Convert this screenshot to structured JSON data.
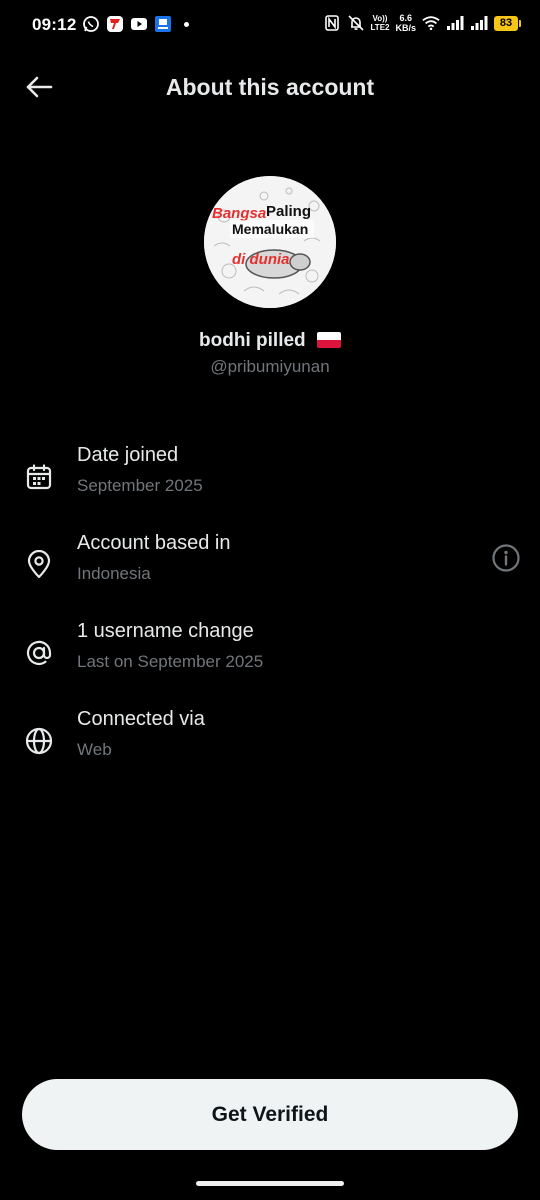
{
  "status_bar": {
    "time": "09:12",
    "volte_top": "Vo))",
    "volte_label": "VoLTE",
    "network_label": "LTE2",
    "speed_value": "6.6",
    "speed_unit": "KB/s",
    "battery": "83",
    "icons": [
      "whatsapp-icon",
      "telkomsel-icon",
      "youtube-icon",
      "app-icon",
      "notification-dot",
      "nfc-icon",
      "mute-icon",
      "wifi-icon",
      "signal-icon",
      "signal-icon",
      "battery-icon"
    ]
  },
  "header": {
    "title": "About this account"
  },
  "profile": {
    "display_name": "bodhi pilled",
    "handle": "@pribumiyunan",
    "avatar_text": {
      "line1a": "Bangsa",
      "line1b": "Paling",
      "line2": "Memalukan",
      "line3": "di dunia"
    }
  },
  "info_items": [
    {
      "icon": "calendar-icon",
      "title": "Date joined",
      "subtitle": "September 2025"
    },
    {
      "icon": "location-pin-icon",
      "title": "Account based in",
      "subtitle": "Indonesia"
    },
    {
      "icon": "at-sign-icon",
      "title": "1 username change",
      "subtitle": "Last on September 2025"
    },
    {
      "icon": "globe-icon",
      "title": "Connected via",
      "subtitle": "Web"
    }
  ],
  "button": {
    "label": "Get Verified"
  },
  "colors": {
    "background": "#000000",
    "text_primary": "#e7e9ea",
    "text_secondary": "#71767b",
    "button_bg": "#eff3f4",
    "button_text": "#0f1419",
    "battery": "#f5c518"
  }
}
